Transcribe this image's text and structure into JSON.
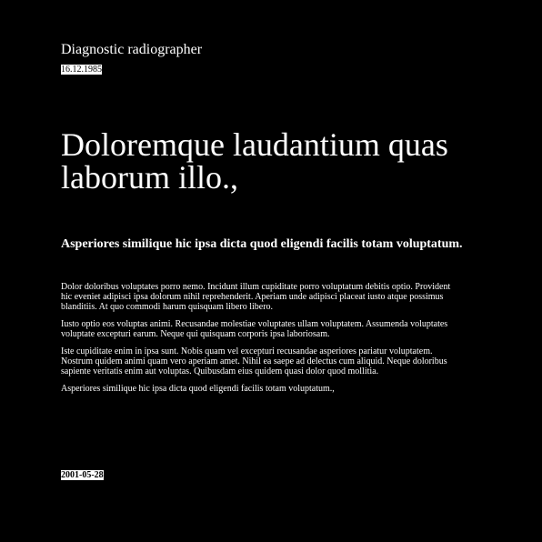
{
  "header": {
    "role": "Diagnostic radiographer",
    "date": "16.12.1985"
  },
  "article": {
    "headline": "Doloremque laudantium quas laborum illo.,",
    "lead": "Asperiores similique hic ipsa dicta quod eligendi facilis totam voluptatum.",
    "paragraphs": [
      "Dolor doloribus voluptates porro nemo. Incidunt illum cupiditate porro voluptatum debitis optio. Provident hic eveniet adipisci ipsa dolorum nihil reprehenderit. Aperiam unde adipisci placeat iusto atque possimus blanditiis. At quo commodi harum quisquam libero libero.",
      "Iusto optio eos voluptas animi. Recusandae molestiae voluptates ullam voluptatem. Assumenda voluptates voluptate excepturi earum. Neque qui quisquam corporis ipsa laboriosam.",
      "Iste cupiditate enim in ipsa sunt. Nobis quam vel excepturi recusandae asperiores pariatur voluptatem. Nostrum quidem animi quam vero aperiam amet. Nihil ea saepe ad delectus cum aliquid. Neque doloribus sapiente veritatis enim aut voluptas. Quibusdam eius quidem quasi dolor quod mollitia.",
      "Asperiores similique hic ipsa dicta quod eligendi facilis totam voluptatum.,"
    ]
  },
  "footer": {
    "date": "2001-05-28"
  }
}
